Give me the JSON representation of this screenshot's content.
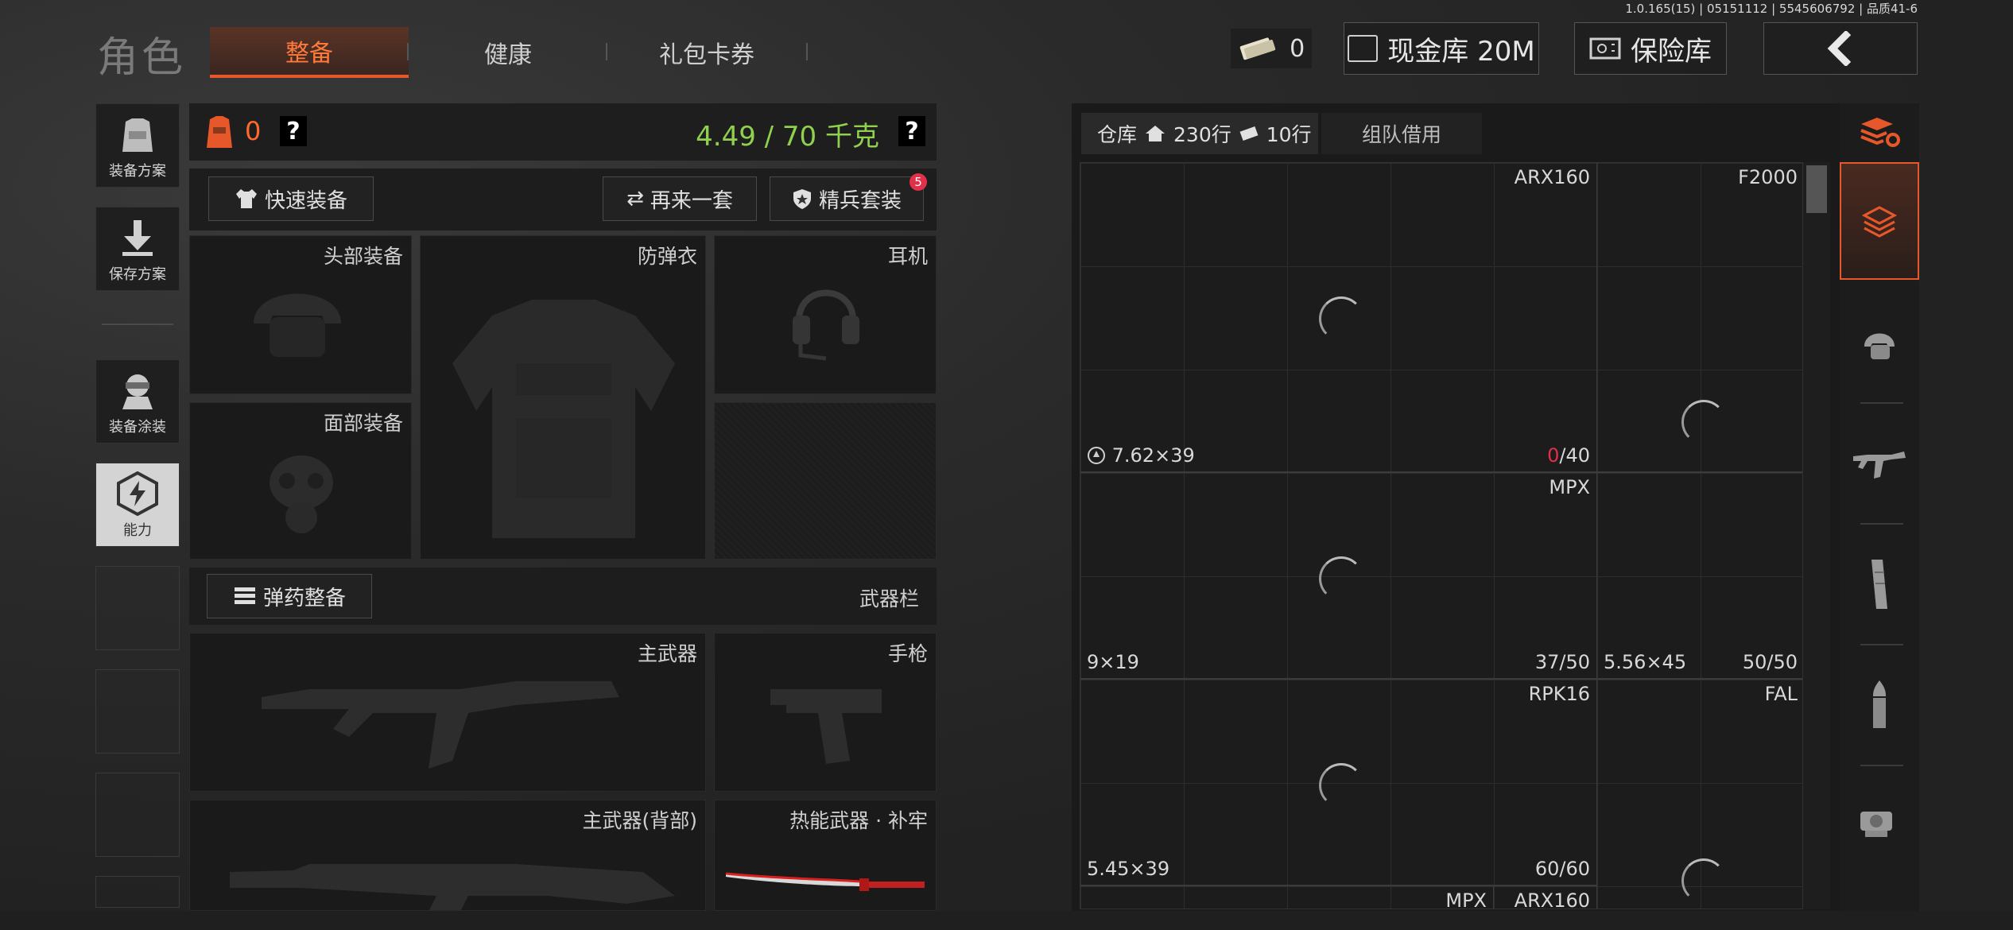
{
  "version": "1.0.165(15) | 05151112 | 5545606792 | 品质41-6",
  "title": "角色",
  "tabs": [
    {
      "label": "整备",
      "active": true
    },
    {
      "label": "健康",
      "active": false
    },
    {
      "label": "礼包卡券",
      "active": false
    }
  ],
  "currency": {
    "value": "0"
  },
  "cash_vault": {
    "label": "现金库 20M"
  },
  "safe_vault": {
    "label": "保险库"
  },
  "left_menu": [
    {
      "label": "装备方案"
    },
    {
      "label": "保存方案"
    },
    {
      "label": "装备涂装"
    },
    {
      "label": "能力"
    }
  ],
  "loadout": {
    "armor_count": "0",
    "help": "?",
    "weight": "4.49 / 70 千克",
    "weight_help": "?",
    "quick_equip": "快速装备",
    "again": "再来一套",
    "elite": "精兵套装",
    "elite_badge": "5",
    "slots": {
      "head": "头部装备",
      "armor": "防弹衣",
      "ear": "耳机",
      "face": "面部装备"
    },
    "ammo_btn": "弹药整备",
    "weapon_bar": "武器栏",
    "weapons": {
      "primary": "主武器",
      "pistol": "手枪",
      "primary_back": "主武器(背部)",
      "melee": "热能武器 · 补牢"
    }
  },
  "storage": {
    "tab_label": "仓库",
    "rows": "230行",
    "cols": "10行",
    "team": "组队借用",
    "items": [
      {
        "name": "ARX160",
        "ammo": "7.62×39",
        "count_red": "0",
        "count_rest": "/40"
      },
      {
        "name": "F2000",
        "ammo": "",
        "count_red": "",
        "count_rest": ""
      },
      {
        "name": "MPX",
        "ammo": "9×19",
        "count_red": "",
        "count_rest": "37/50"
      },
      {
        "name": "",
        "ammo": "5.56×45",
        "count_red": "",
        "count_rest": "50/50"
      },
      {
        "name": "RPK16",
        "ammo": "5.45×39",
        "count_red": "",
        "count_rest": "60/60"
      },
      {
        "name": "FAL",
        "ammo": "",
        "count_red": "",
        "count_rest": ""
      },
      {
        "name": "MPX",
        "ammo": "",
        "count_red": "",
        "count_rest": ""
      },
      {
        "name": "ARX160",
        "ammo": "",
        "count_red": "",
        "count_rest": ""
      }
    ]
  },
  "colors": {
    "accent": "#e6582a",
    "weight": "#8fd14f",
    "red": "#e0304a"
  }
}
